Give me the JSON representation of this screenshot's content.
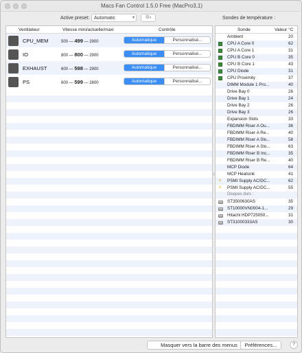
{
  "window": {
    "title": "Macs Fan Control 1.5.0 Free (MacPro3,1)"
  },
  "toolbar": {
    "preset_label": "Active preset:",
    "preset_value": "Automatic",
    "sondes_title": "Sondes de température :"
  },
  "fans_header": {
    "col_fan": "Ventilateur",
    "col_speed": "Vitesse mini/actuelle/maxi",
    "col_control": "Contrôle"
  },
  "fans": [
    {
      "name": "CPU_MEM",
      "min": "500",
      "current": "499",
      "max": "2900",
      "auto_label": "Automatique",
      "manual_label": "Personnalisé..."
    },
    {
      "name": "IO",
      "min": "800",
      "current": "800",
      "max": "2900",
      "auto_label": "Automatique",
      "manual_label": "Personnalisé..."
    },
    {
      "name": "EXHAUST",
      "min": "600",
      "current": "598",
      "max": "2900",
      "auto_label": "Automatique",
      "manual_label": "Personnalisé..."
    },
    {
      "name": "PS",
      "min": "600",
      "current": "599",
      "max": "2800",
      "auto_label": "Automatique",
      "manual_label": "Personnalisé..."
    }
  ],
  "sensors_header": {
    "col_sensor": "Sonde",
    "col_value": "Valeur °C"
  },
  "sensors": [
    {
      "name": "Ambient",
      "value": "20",
      "icon": "none"
    },
    {
      "name": "CPU A Core 0",
      "value": "62",
      "icon": "chip"
    },
    {
      "name": "CPU A Core 1",
      "value": "31",
      "icon": "chip"
    },
    {
      "name": "CPU B Core 0",
      "value": "35",
      "icon": "chip"
    },
    {
      "name": "CPU B Core 1",
      "value": "43",
      "icon": "chip"
    },
    {
      "name": "CPU Diode",
      "value": "31",
      "icon": "chip"
    },
    {
      "name": "CPU Proximity",
      "value": "37",
      "icon": "chip"
    },
    {
      "name": "DIMM Module 1 Pro...",
      "value": "40",
      "icon": "none"
    },
    {
      "name": "Drive Bay 0",
      "value": "26",
      "icon": "none"
    },
    {
      "name": "Drive Bay 1",
      "value": "24",
      "icon": "none"
    },
    {
      "name": "Drive Bay 2",
      "value": "26",
      "icon": "none"
    },
    {
      "name": "Drive Bay 3",
      "value": "26",
      "icon": "none"
    },
    {
      "name": "Expansion Slots",
      "value": "33",
      "icon": "none"
    },
    {
      "name": "FBDIMM Riser A Ou...",
      "value": "36",
      "icon": "none"
    },
    {
      "name": "FBDIMM Riser A Re...",
      "value": "40",
      "icon": "none"
    },
    {
      "name": "FBDIMM Riser A Slo...",
      "value": "58",
      "icon": "none"
    },
    {
      "name": "FBDIMM Riser A Slo...",
      "value": "63",
      "icon": "none"
    },
    {
      "name": "FBDIMM Riser B Inc...",
      "value": "35",
      "icon": "none"
    },
    {
      "name": "FBDIMM Riser B Re...",
      "value": "40",
      "icon": "none"
    },
    {
      "name": "MCP Diode",
      "value": "64",
      "icon": "none"
    },
    {
      "name": "MCP Heatsink",
      "value": "41",
      "icon": "none"
    },
    {
      "name": "PSMI Supply AC/DC...",
      "value": "62",
      "icon": "bolt"
    },
    {
      "name": "PSMI Supply AC/DC...",
      "value": "55",
      "icon": "bolt"
    }
  ],
  "disks_label": "Disques durs :",
  "disks": [
    {
      "name": "ST3500630AS",
      "value": "35"
    },
    {
      "name": "ST10000VN0004-1...",
      "value": "29"
    },
    {
      "name": "Hitachi HDP725050...",
      "value": "31"
    },
    {
      "name": "ST31000333AS",
      "value": "30"
    }
  ],
  "footer": {
    "hide_label": "Masquer vers la barre des menus",
    "prefs_label": "Préférences...",
    "help_label": "?"
  }
}
